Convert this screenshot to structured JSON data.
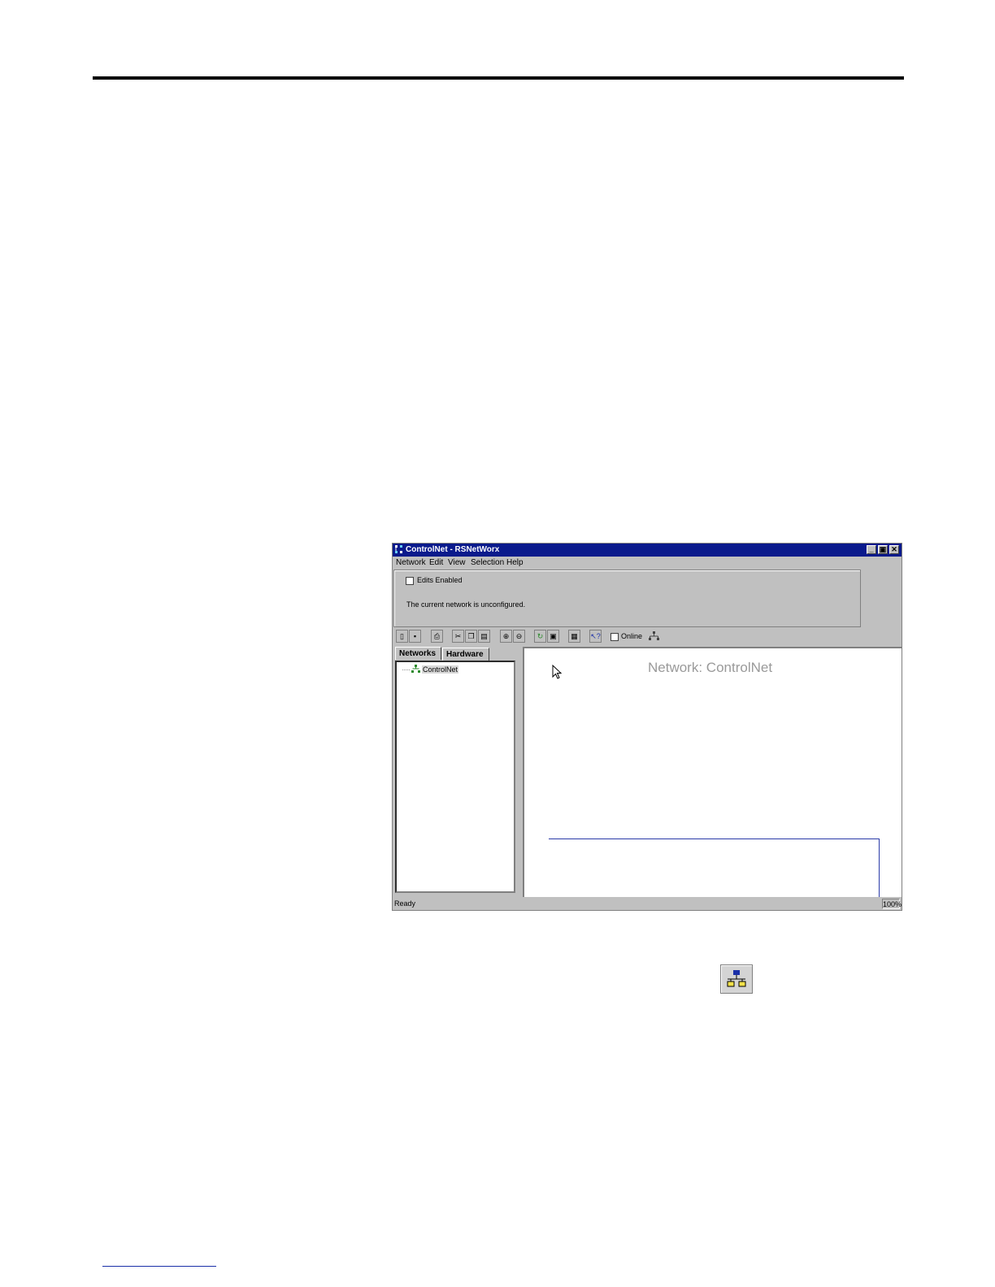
{
  "window": {
    "title": "ControlNet - RSNetWorx",
    "buttons": [
      "_",
      "▣",
      "✕"
    ]
  },
  "menu": [
    "Network",
    "Edit",
    "View",
    "Selection",
    "Help"
  ],
  "top_panel": {
    "edits_enabled_label": "Edits Enabled",
    "message": "The current network is unconfigured."
  },
  "toolbar": {
    "online_label": "Online"
  },
  "tabs": [
    "Networks",
    "Hardware"
  ],
  "tree": {
    "node_label": "ControlNet"
  },
  "canvas": {
    "title": "Network: ControlNet"
  },
  "status": {
    "text": "Ready",
    "zoom": "100%"
  },
  "colors": {
    "titlebar": "#0a1a8c",
    "trunk_line": "#2a3aa8",
    "network_icon_top": "#1a2fa8",
    "network_icon_nodes": "#f2e14a"
  }
}
